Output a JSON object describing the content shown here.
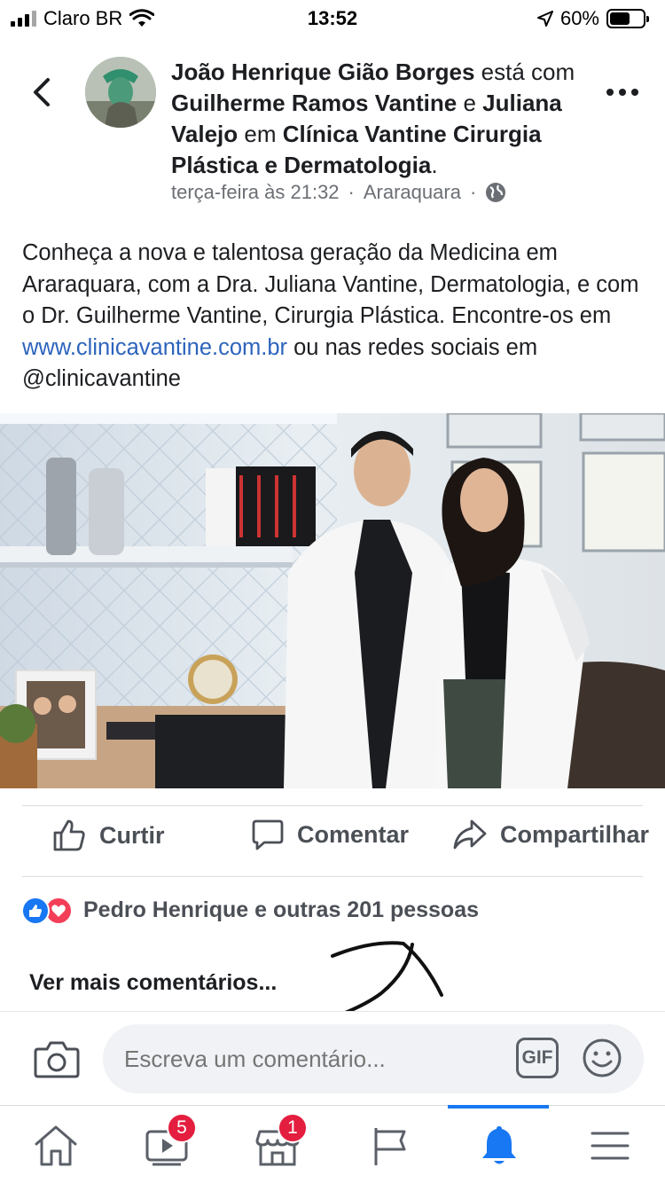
{
  "status_bar": {
    "carrier": "Claro BR",
    "time": "13:52",
    "battery": "60%",
    "battery_level": 0.6
  },
  "post": {
    "author": "João Henrique Gião Borges",
    "is_with": "está com",
    "tagged1": "Guilherme Ramos Vantine",
    "and": "e",
    "tagged2": "Juliana Valejo",
    "at": "em",
    "place": "Clínica Vantine Cirurgia Plástica e Dermatologia",
    "period": ".",
    "time": "terça-feira às 21:32",
    "location": "Araraquara",
    "separator": "·",
    "text_before_link": "Conheça a nova e talentosa geração da Medicina em Araraquara, com a Dra. Juliana Vantine, Dermatologia, e com o Dr. Guilherme Vantine, Cirurgia Plástica. Encontre-os em ",
    "link": "www.clinicavantine.com.br",
    "text_after_link": " ou nas redes sociais em @clinicavantine"
  },
  "actions": {
    "like": "Curtir",
    "comment": "Comentar",
    "share": "Compartilhar"
  },
  "reactions": {
    "summary": "Pedro Henrique e outras 201 pessoas"
  },
  "comments": {
    "see_more": "Ver mais comentários..."
  },
  "composer": {
    "placeholder": "Escreva um comentário...",
    "gif": "GIF"
  },
  "tabbar": {
    "watch_badge": "5",
    "marketplace_badge": "1"
  },
  "colors": {
    "link": "#2d64bc",
    "accent": "#1877f2",
    "badge": "#e41e3f",
    "highlight": "#fae36e"
  }
}
